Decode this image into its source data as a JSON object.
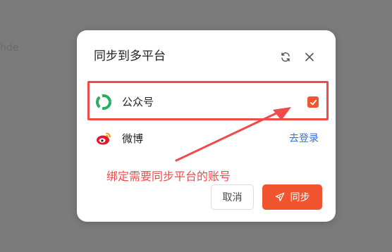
{
  "background": {
    "partial_text": "hde"
  },
  "dialog": {
    "title": "同步到多平台",
    "platforms": [
      {
        "name": "公众号",
        "checked": true,
        "logo": "wechat-official-account-icon"
      },
      {
        "name": "微博",
        "action_label": "去登录",
        "logo": "weibo-icon"
      }
    ],
    "buttons": {
      "cancel": "取消",
      "sync": "同步"
    }
  },
  "annotation": {
    "text": "绑定需要同步平台的账号"
  },
  "colors": {
    "accent": "#f0552f",
    "highlight": "#f04a4a",
    "link": "#2f6fe5"
  }
}
